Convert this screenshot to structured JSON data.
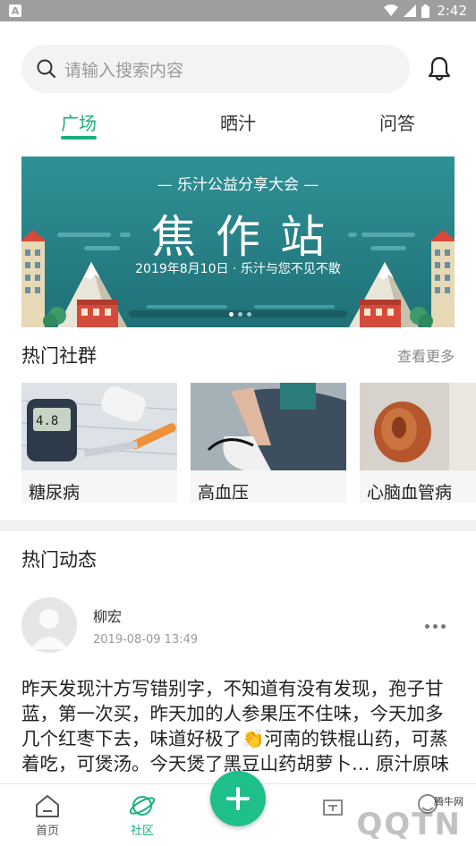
{
  "status_bar": {
    "time": "2:42",
    "badge": "A"
  },
  "search": {
    "placeholder": "请输入搜索内容"
  },
  "tabs": [
    {
      "label": "广场",
      "active": true
    },
    {
      "label": "晒汁",
      "active": false
    },
    {
      "label": "问答",
      "active": false
    }
  ],
  "banner": {
    "subtitle": "— 乐汁公益分享大会 —",
    "title": "焦作站",
    "date_line": "2019年8月10日 · 乐汁与您不见不散",
    "colors": {
      "sky": "#2b8a8e",
      "ground": "#1f6d72"
    },
    "page_count": 3,
    "active_page": 1
  },
  "hot_groups": {
    "title": "热门社群",
    "more": "查看更多",
    "items": [
      {
        "name": "糖尿病",
        "image": "glucose-meter-image"
      },
      {
        "name": "高血压",
        "image": "blood-pressure-image"
      },
      {
        "name": "心脑血管病",
        "image": "organ-image"
      }
    ]
  },
  "hot_feed": {
    "title": "热门动态",
    "post": {
      "author": "柳宏",
      "time": "2019-08-09 13:49",
      "text": "昨天发现汁方写错别字，不知道有没有发现，孢子甘蓝，第一次买，昨天加的人参果压不住味，今天加多几个红枣下去，味道好极了👏河南的铁棍山药，可蒸着吃，可煲汤。今天煲了黑豆山药胡萝卜… 原汁原味"
    }
  },
  "bottom_nav": [
    {
      "label": "首页",
      "icon": "home-icon",
      "active": false
    },
    {
      "label": "社区",
      "icon": "planet-icon",
      "active": true
    },
    {
      "label": "",
      "icon": "add-icon",
      "active": false
    },
    {
      "label": "",
      "icon": "wallet-icon",
      "active": false
    },
    {
      "label": "",
      "icon": "profile-icon",
      "active": false
    }
  ],
  "watermark": {
    "text": "腾牛网",
    "logo": "QQTN"
  },
  "colors": {
    "accent": "#19b07a",
    "fab": "#1fbf8c"
  }
}
